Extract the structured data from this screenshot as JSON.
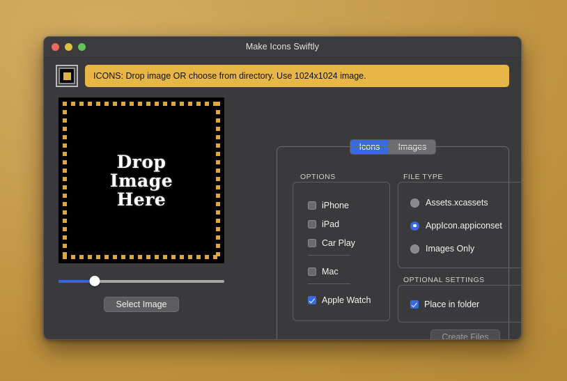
{
  "desktop": {
    "background_color": "#c79b4e"
  },
  "window": {
    "title": "Make Icons Swiftly",
    "traffic_lights": {
      "close": "close-button",
      "minimize": "minimize-button",
      "maximize": "maximize-button"
    }
  },
  "banner": {
    "icon_name": "app-icon",
    "text": "ICONS: Drop image OR choose from directory. Use 1024x1024 image.",
    "background_color": "#e8b547",
    "text_color": "#121212"
  },
  "dropzone": {
    "label_line1": "Drop",
    "label_line2": "Image",
    "label_line3": "Here",
    "border_color": "#e0a83a",
    "background_color": "#000000"
  },
  "slider": {
    "value_percent": 22,
    "fill_color": "#3a63d8",
    "track_color": "#a8a8a8"
  },
  "buttons": {
    "select_image": "Select Image",
    "create_files": "Create Files"
  },
  "tabs": {
    "items": [
      {
        "label": "Icons",
        "selected": true
      },
      {
        "label": "Images",
        "selected": false
      }
    ],
    "accent_color": "#3a6ae0"
  },
  "options": {
    "section_label": "OPTIONS",
    "items": [
      {
        "label": "iPhone",
        "checked": false
      },
      {
        "label": "iPad",
        "checked": false
      },
      {
        "label": "Car Play",
        "checked": false
      },
      {
        "label": "Mac",
        "checked": false
      },
      {
        "label": "Apple Watch",
        "checked": true
      }
    ]
  },
  "file_type": {
    "section_label": "FILE TYPE",
    "items": [
      {
        "label": "Assets.xcassets",
        "selected": false
      },
      {
        "label": "AppIcon.appiconset",
        "selected": true
      },
      {
        "label": "Images Only",
        "selected": false
      }
    ]
  },
  "optional_settings": {
    "section_label": "OPTIONAL SETTINGS",
    "items": [
      {
        "label": "Place in folder",
        "checked": true
      }
    ]
  }
}
